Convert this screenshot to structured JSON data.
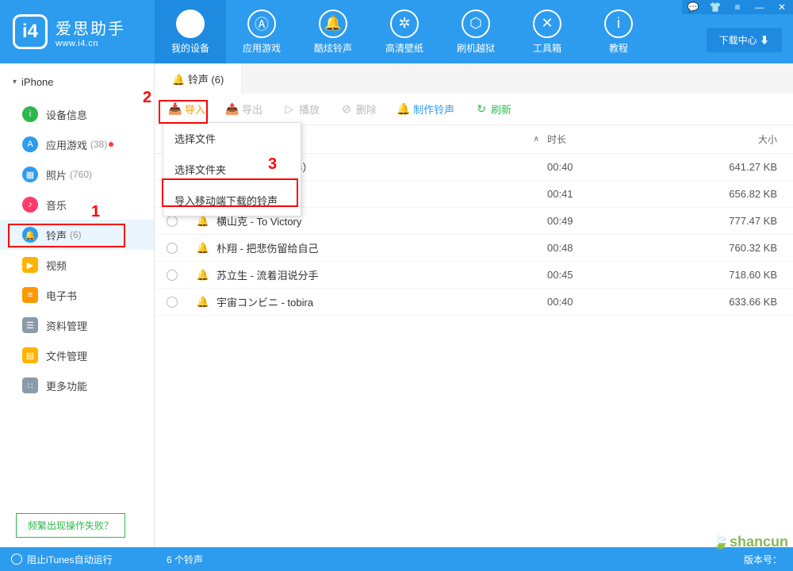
{
  "app": {
    "title": "爱思助手",
    "url": "www.i4.cn"
  },
  "download_center": "下载中心",
  "nav": [
    {
      "label": "我的设备"
    },
    {
      "label": "应用游戏"
    },
    {
      "label": "酷炫铃声"
    },
    {
      "label": "高清壁纸"
    },
    {
      "label": "刷机越狱"
    },
    {
      "label": "工具箱"
    },
    {
      "label": "教程"
    }
  ],
  "device": {
    "name": "iPhone"
  },
  "sidebar": [
    {
      "label": "设备信息",
      "color": "#2eb84c",
      "icon": "i"
    },
    {
      "label": "应用游戏",
      "count": "(38)",
      "dot": true,
      "color": "#2d9cee",
      "icon": "A"
    },
    {
      "label": "照片",
      "count": "(760)",
      "color": "#2d9cee",
      "icon": "▦"
    },
    {
      "label": "音乐",
      "color": "#ff3b6b",
      "icon": "♪"
    },
    {
      "label": "铃声",
      "count": "(6)",
      "color": "#2d9cee",
      "icon": "🔔",
      "active": true
    },
    {
      "label": "视频",
      "color": "#ffb300",
      "icon": "▶",
      "sq": true
    },
    {
      "label": "电子书",
      "color": "#ff9800",
      "icon": "≡",
      "sq": true
    },
    {
      "label": "资料管理",
      "color": "#8b9aa7",
      "icon": "☰",
      "sq": true
    },
    {
      "label": "文件管理",
      "color": "#ffb300",
      "icon": "▤",
      "sq": true
    },
    {
      "label": "更多功能",
      "color": "#8b9aa7",
      "icon": "∷",
      "sq": true
    }
  ],
  "faq": "频繁出现操作失败？",
  "tab": {
    "label": "铃声 (6)"
  },
  "toolbar": {
    "import": "导入",
    "export": "导出",
    "play": "播放",
    "delete": "删除",
    "make": "制作铃声",
    "refresh": "刷新"
  },
  "dropdown": {
    "select_file": "选择文件",
    "select_folder": "选择文件夹",
    "import_mobile": "导入移动端下载的铃声"
  },
  "table": {
    "head": {
      "duration": "时长",
      "size": "大小"
    },
    "rows": [
      {
        "name": "Me to Sleep（前奏）",
        "duration": "00:40",
        "size": "641.27 KB"
      },
      {
        "name": "",
        "duration": "00:41",
        "size": "656.82 KB"
      },
      {
        "name": "横山克 - To Victory",
        "duration": "00:49",
        "size": "777.47 KB"
      },
      {
        "name": "朴翔 - 把悲伤留给自己",
        "duration": "00:48",
        "size": "760.32 KB"
      },
      {
        "name": "苏立生 - 流着泪说分手",
        "duration": "00:45",
        "size": "718.60 KB"
      },
      {
        "name": "宇宙コンビニ - tobira",
        "duration": "00:40",
        "size": "633.66 KB"
      }
    ]
  },
  "annotations": {
    "a1": "1",
    "a2": "2",
    "a3": "3"
  },
  "status": {
    "itunes": "阻止iTunes自动运行",
    "count": "6 个铃声",
    "version": "版本号："
  },
  "watermark": "shancun"
}
